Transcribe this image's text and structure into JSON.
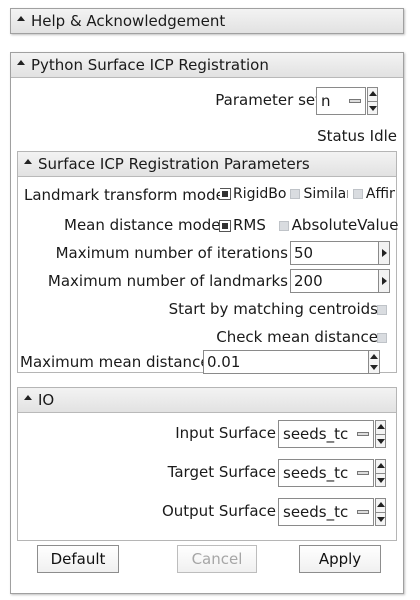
{
  "help_section": {
    "title": "Help & Acknowledgement"
  },
  "main_section": {
    "title": "Python Surface ICP Registration",
    "parameter_set_label": "Parameter set",
    "parameter_set_value": "n",
    "status_text": "Status Idle"
  },
  "params_section": {
    "title": "Surface ICP Registration Parameters",
    "landmark_transform_label": "Landmark transform mode",
    "landmark_options": [
      {
        "label": "RigidBody",
        "selected": true
      },
      {
        "label": "Similarity",
        "selected": false
      },
      {
        "label": "Affine",
        "selected": false
      }
    ],
    "mean_distance_mode_label": "Mean distance mode",
    "mean_distance_options": [
      {
        "label": "RMS",
        "selected": true
      },
      {
        "label": "AbsoluteValue",
        "selected": false
      }
    ],
    "max_iterations_label": "Maximum number of iterations",
    "max_iterations_value": "50",
    "max_landmarks_label": "Maximum number of landmarks",
    "max_landmarks_value": "200",
    "start_centroids_label": "Start by matching centroids",
    "start_centroids_checked": false,
    "check_mean_label": "Check mean distance",
    "check_mean_checked": false,
    "max_mean_distance_label": "Maximum mean distance",
    "max_mean_distance_value": "0.01"
  },
  "io_section": {
    "title": "IO",
    "input_label": "Input Surface",
    "input_value": "seeds_tc",
    "target_label": "Target Surface",
    "target_value": "seeds_tc",
    "output_label": "Output Surface",
    "output_value": "seeds_tc"
  },
  "buttons": {
    "default": "Default",
    "cancel": "Cancel",
    "apply": "Apply"
  }
}
